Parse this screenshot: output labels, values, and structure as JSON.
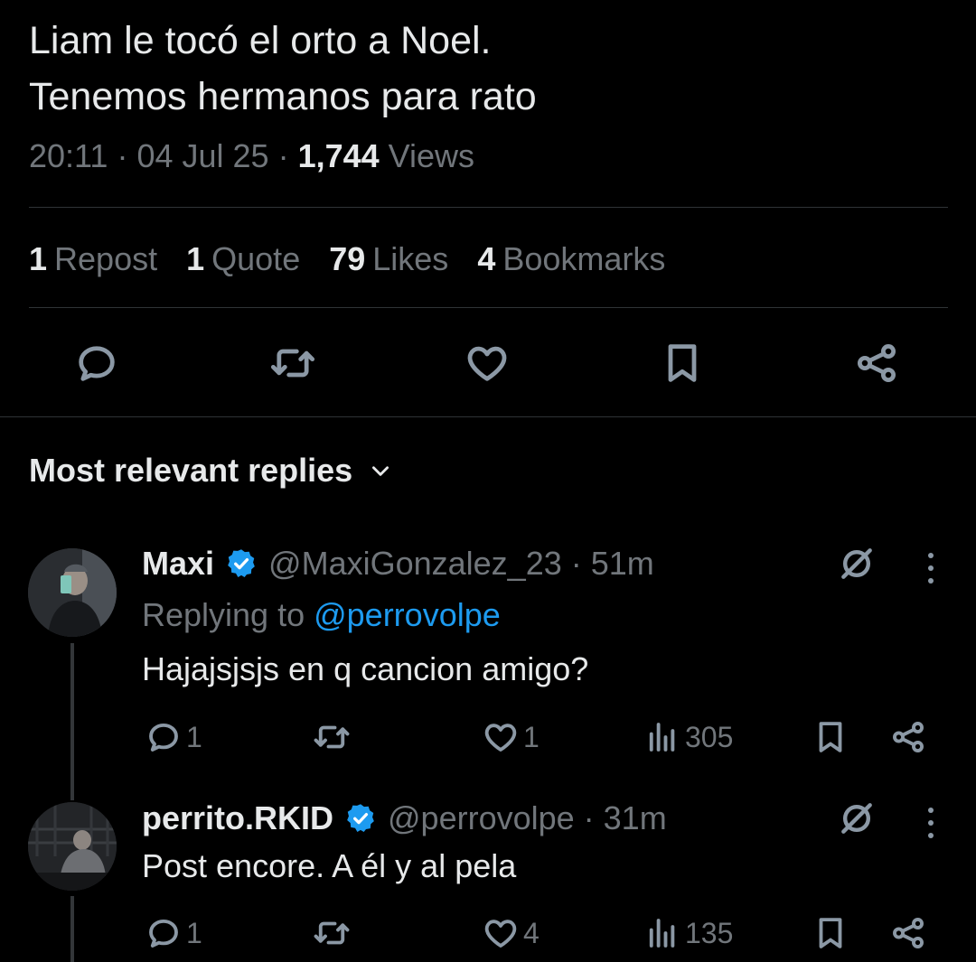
{
  "tweet": {
    "line1": "Liam le tocó el orto a Noel.",
    "line2": "Tenemos hermanos para rato",
    "time": "20:11",
    "date": "04 Jul 25",
    "views_count": "1,744",
    "views_label": "Views"
  },
  "stats": {
    "reposts_count": "1",
    "reposts_label": "Repost",
    "quotes_count": "1",
    "quotes_label": "Quote",
    "likes_count": "79",
    "likes_label": "Likes",
    "bookmarks_count": "4",
    "bookmarks_label": "Bookmarks"
  },
  "actions": [
    "reply-icon",
    "repost-icon",
    "like-icon",
    "bookmark-icon",
    "share-icon"
  ],
  "replies_header": {
    "label": "Most relevant replies"
  },
  "replies": [
    {
      "name": "Maxi",
      "handle": "@MaxiGonzalez_23 · 51m",
      "replying_prefix": "Replying to ",
      "replying_to": "@perrovolpe",
      "text": "Hajajsjsjs en q cancion amigo?",
      "reply_count": "1",
      "repost_count": "",
      "like_count": "1",
      "views": "305"
    },
    {
      "name": "perrito.RKID",
      "handle": "@perrovolpe · 31m",
      "text": "Post encore. A él y al pela",
      "reply_count": "1",
      "repost_count": "",
      "like_count": "4",
      "views": "135"
    }
  ],
  "colors": {
    "background": "#000000",
    "text": "#e7e9ea",
    "secondary": "#71767b",
    "link": "#1d9bf0",
    "verified": "#1d9bf0"
  }
}
